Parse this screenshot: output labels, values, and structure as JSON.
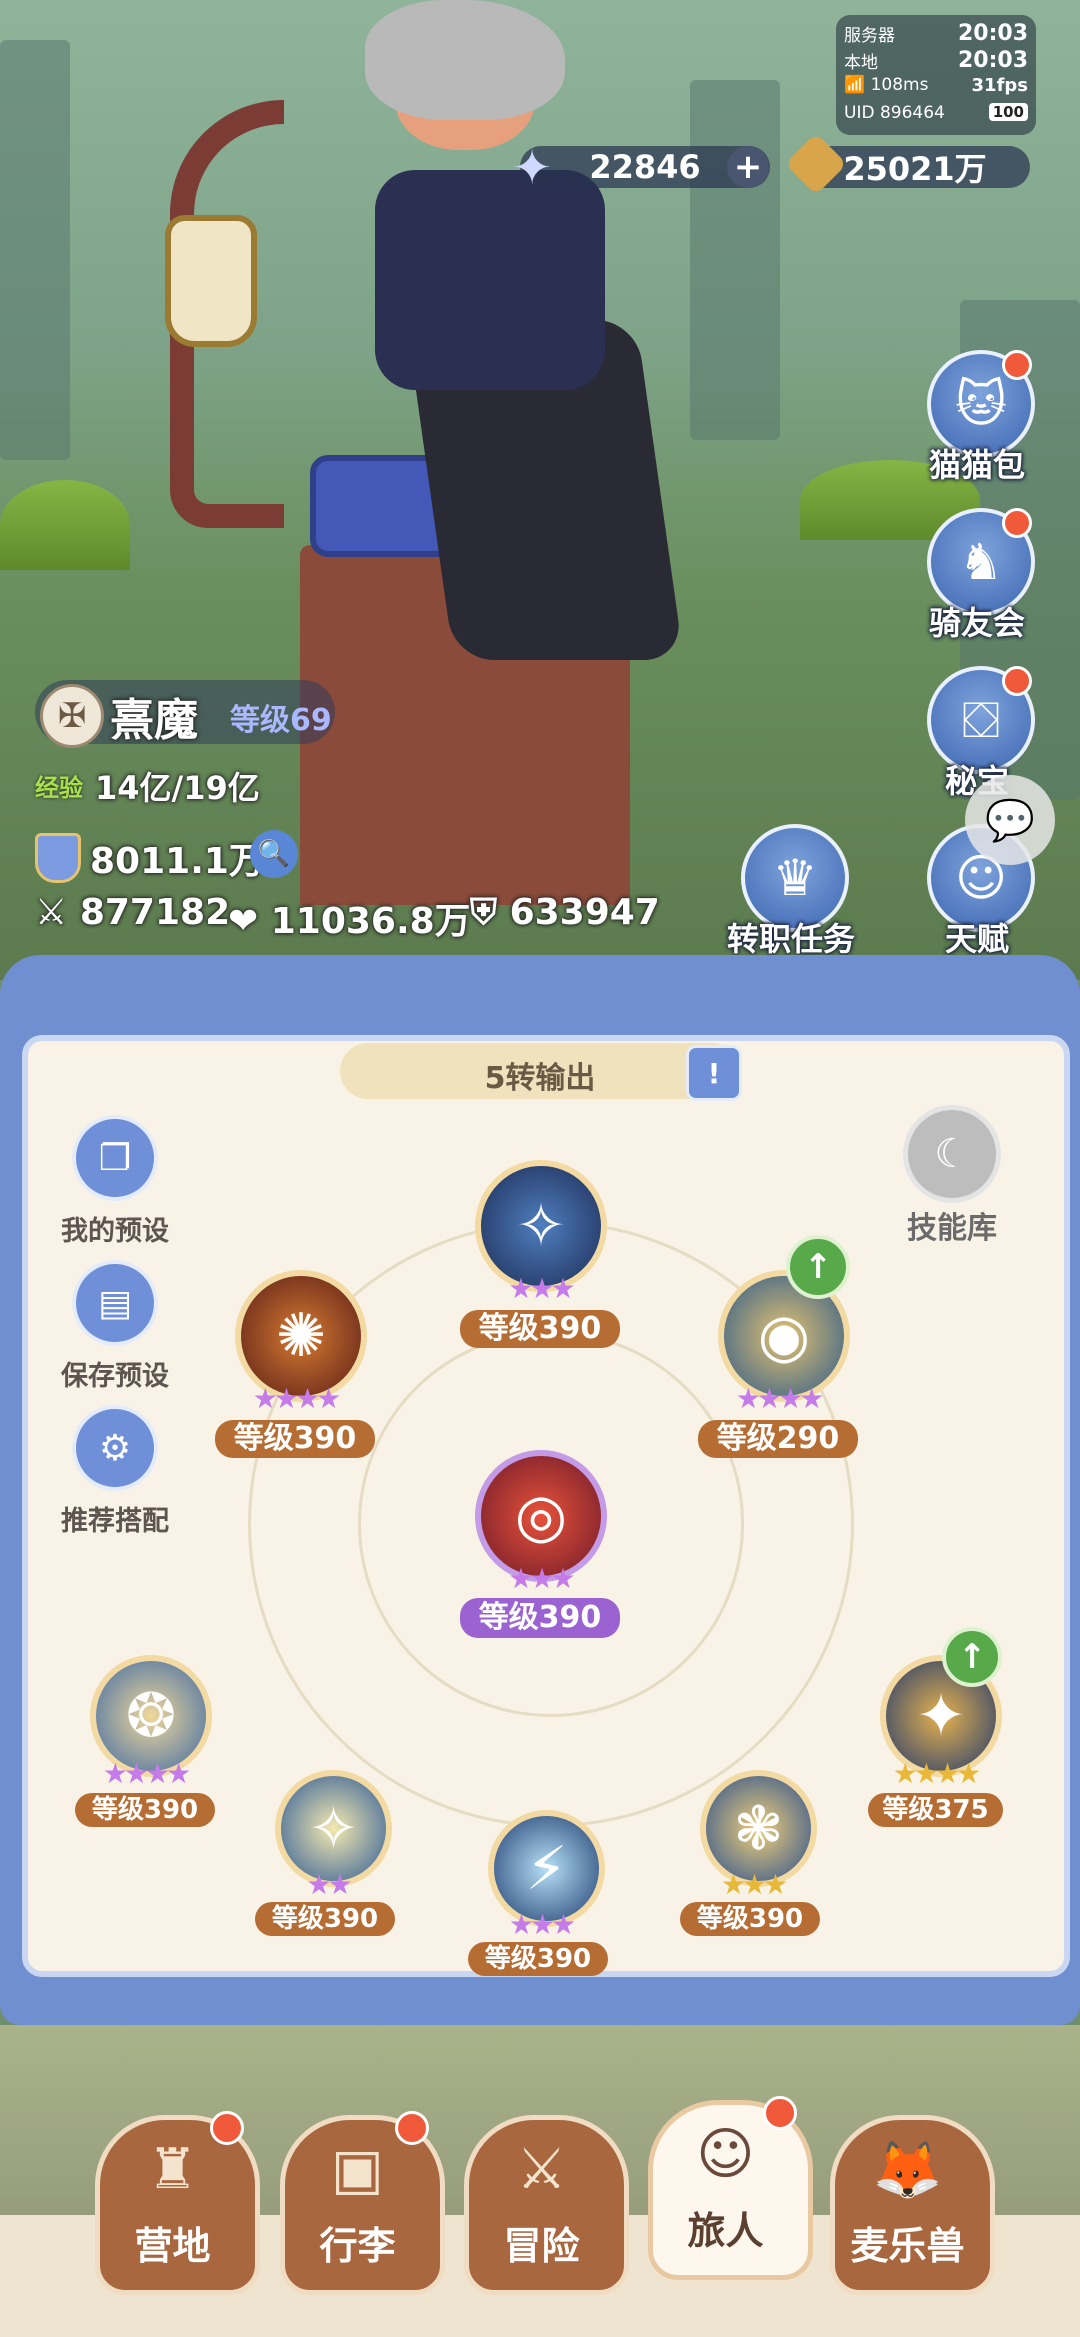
{
  "status": {
    "server_label": "服务器",
    "server_time": "20:03",
    "local_label": "本地",
    "local_time": "20:03",
    "ping": "108ms",
    "fps": "31fps",
    "uid": "UID 896464",
    "battery": "100"
  },
  "resources": {
    "diamonds": "22846",
    "gold": "25021万"
  },
  "side_menu": [
    {
      "label": "猫猫包",
      "icon": "cat-bag-icon"
    },
    {
      "label": "骑友会",
      "icon": "horse-icon"
    },
    {
      "label": "秘宝",
      "icon": "treasure-icon"
    },
    {
      "label": "天赋",
      "icon": "talent-icon"
    }
  ],
  "job_quest": {
    "label": "转职任务"
  },
  "character": {
    "name": "熹魔",
    "level": "等级69",
    "exp_label": "经验",
    "exp": "14亿/19亿",
    "power": "8011.1万",
    "attack": "877182",
    "hp": "11036.8万",
    "defense": "633947"
  },
  "panel": {
    "title": "5转输出",
    "skill_library": "技能库",
    "tools": [
      "我的预设",
      "保存预设",
      "推荐搭配"
    ]
  },
  "skills": {
    "top": "等级390",
    "left": "等级390",
    "right": "等级290",
    "center": "等级390",
    "bottom": [
      "等级390",
      "等级390",
      "等级390",
      "等级390",
      "等级375"
    ]
  },
  "nav": [
    {
      "label": "营地",
      "icon": "castle-icon"
    },
    {
      "label": "行李",
      "icon": "luggage-icon"
    },
    {
      "label": "冒险",
      "icon": "swords-icon"
    },
    {
      "label": "旅人",
      "icon": "traveler-icon"
    },
    {
      "label": "麦乐兽",
      "icon": "pet-icon"
    }
  ],
  "colors": {
    "accent_blue": "#6f8fd0",
    "level_badge": "#b56d34",
    "notify_red": "#f05a3a"
  }
}
